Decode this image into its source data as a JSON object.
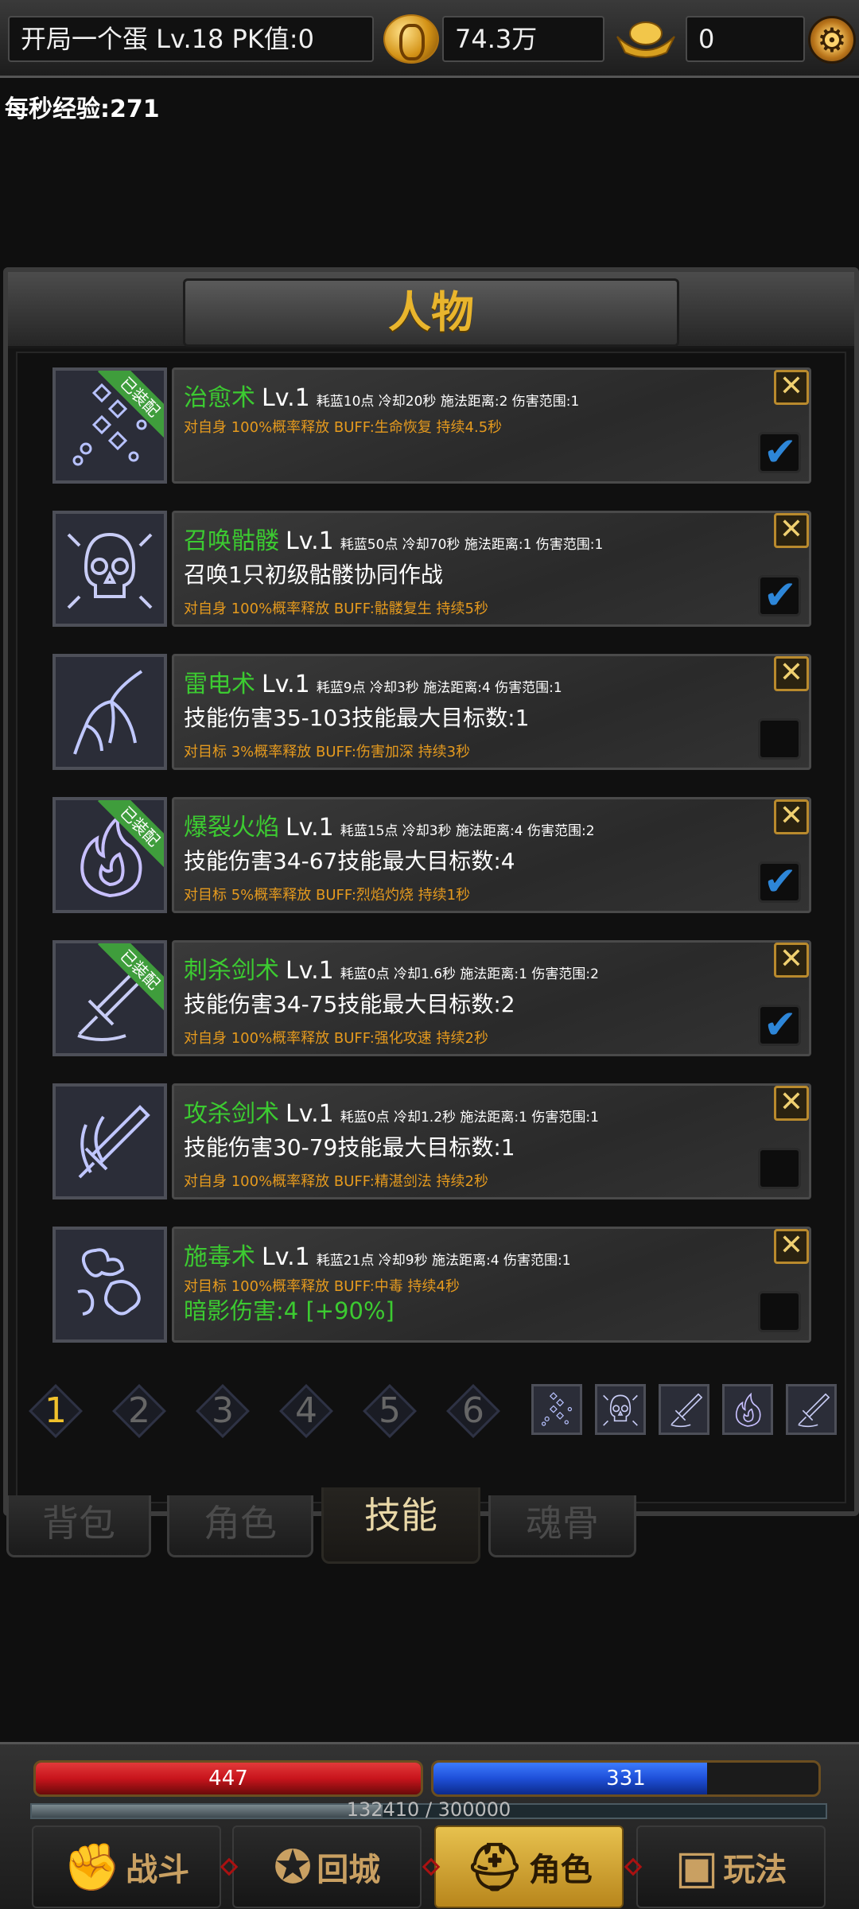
{
  "topbar": {
    "player": "开局一个蛋  Lv.18 PK值:0",
    "gold": "74.3万",
    "ingot": "0",
    "icons": {
      "coin": "gold-coin-icon",
      "ingot": "gold-ingot-icon",
      "settings": "gear-icon"
    }
  },
  "exp_rate": "每秒经验:271",
  "panel": {
    "title": "人物"
  },
  "equipped_label": "已装配",
  "close_glyph": "✕",
  "check_glyph": "✔",
  "skills": [
    {
      "name": "治愈术",
      "level": "Lv.1",
      "stats": "耗蓝10点 冷却20秒 施法距离:2 伤害范围:1",
      "desc": "",
      "buff": "对自身 100%概率释放 BUFF:生命恢复 持续4.5秒",
      "bonus": "",
      "equipped": true,
      "checked": true,
      "icon": "healing-rune-icon"
    },
    {
      "name": "召唤骷髅",
      "level": "Lv.1",
      "stats": "耗蓝50点 冷却70秒 施法距离:1 伤害范围:1",
      "desc": "召唤1只初级骷髅协同作战",
      "buff": "对自身 100%概率释放 BUFF:骷髅复生 持续5秒",
      "bonus": "",
      "equipped": false,
      "checked": true,
      "icon": "skull-icon"
    },
    {
      "name": "雷电术",
      "level": "Lv.1",
      "stats": "耗蓝9点 冷却3秒 施法距离:4 伤害范围:1",
      "desc": "技能伤害35-103技能最大目标数:1",
      "buff": "对目标 3%概率释放 BUFF:伤害加深 持续3秒",
      "bonus": "",
      "equipped": false,
      "checked": false,
      "icon": "lightning-icon"
    },
    {
      "name": "爆裂火焰",
      "level": "Lv.1",
      "stats": "耗蓝15点 冷却3秒 施法距离:4 伤害范围:2",
      "desc": "技能伤害34-67技能最大目标数:4",
      "buff": "对目标 5%概率释放 BUFF:烈焰灼烧 持续1秒",
      "bonus": "",
      "equipped": true,
      "checked": true,
      "icon": "flame-icon"
    },
    {
      "name": "刺杀剑术",
      "level": "Lv.1",
      "stats": "耗蓝0点 冷却1.6秒 施法距离:1 伤害范围:2",
      "desc": "技能伤害34-75技能最大目标数:2",
      "buff": "对自身 100%概率释放 BUFF:强化攻速 持续2秒",
      "bonus": "",
      "equipped": true,
      "checked": true,
      "icon": "sword-thrust-icon"
    },
    {
      "name": "攻杀剑术",
      "level": "Lv.1",
      "stats": "耗蓝0点 冷却1.2秒 施法距离:1 伤害范围:1",
      "desc": "技能伤害30-79技能最大目标数:1",
      "buff": "对自身 100%概率释放 BUFF:精湛剑法 持续2秒",
      "bonus": "",
      "equipped": false,
      "checked": false,
      "icon": "flaming-sword-icon"
    },
    {
      "name": "施毒术",
      "level": "Lv.1",
      "stats": "耗蓝21点 冷却9秒 施法距离:4 伤害范围:1",
      "desc": "",
      "buff": "对目标 100%概率释放 BUFF:中毒 持续4秒",
      "bonus": "暗影伤害:4 [+90%]",
      "equipped": false,
      "checked": false,
      "icon": "poison-cloud-icon"
    }
  ],
  "pages": [
    "1",
    "2",
    "3",
    "4",
    "5",
    "6"
  ],
  "active_page": "1",
  "equipped_bar": [
    "healing-rune-icon",
    "skull-icon",
    "sword-thrust-icon",
    "flame-icon",
    "sword-thrust-icon"
  ],
  "tabs": [
    {
      "label": "背包",
      "active": false
    },
    {
      "label": "角色",
      "active": false
    },
    {
      "label": "技能",
      "active": true
    },
    {
      "label": "魂骨",
      "active": false
    }
  ],
  "hud": {
    "hp": "447",
    "hp_fill": 1.0,
    "hp_color": "#c8141c",
    "mp": "331",
    "mp_fill": 0.71,
    "mp_color": "#1e4fd8",
    "exp": "132410 / 300000",
    "exp_fill": 0.4414,
    "nav": [
      {
        "label": "战斗",
        "icon": "fist-icon"
      },
      {
        "label": "回城",
        "icon": "pentagram-icon"
      },
      {
        "label": "角色",
        "icon": "helmet-icon"
      },
      {
        "label": "玩法",
        "icon": "treasure-chest-icon"
      }
    ]
  },
  "colors": {
    "accent_gold": "#e9b52d",
    "skill_name_green": "#3ccb31",
    "buff_orange": "#e59a1e",
    "checkbox_blue": "#2d86d8"
  }
}
